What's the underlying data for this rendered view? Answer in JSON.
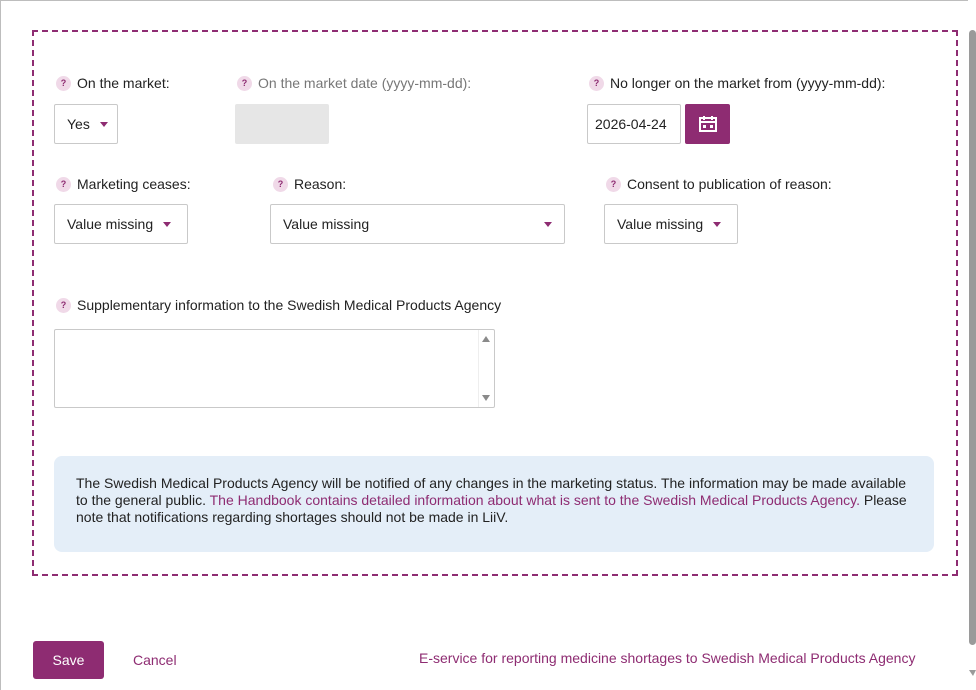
{
  "fields": {
    "on_market": {
      "label": "On the market:",
      "value": "Yes"
    },
    "on_market_date": {
      "label": "On the market date (yyyy-mm-dd):",
      "value": ""
    },
    "no_longer_on_market": {
      "label": "No longer on the market from (yyyy-mm-dd):",
      "value": "2026-04-24"
    },
    "marketing_ceases": {
      "label": "Marketing ceases:",
      "value": "Value missing"
    },
    "reason": {
      "label": "Reason:",
      "value": "Value missing"
    },
    "consent": {
      "label": "Consent to publication of reason:",
      "value": "Value missing"
    },
    "supplementary": {
      "label": "Supplementary information to the Swedish Medical Products Agency",
      "value": ""
    }
  },
  "help_icon_glyph": "?",
  "info": {
    "text_1": "The Swedish Medical Products Agency will be notified of any changes in the marketing status. The information may be made available to the general public.",
    "link": "The Handbook contains detailed information about what is sent to the Swedish Medical Products Agency.",
    "text_2": "Please note that notifications regarding shortages should not be made in LiiV."
  },
  "actions": {
    "save": "Save",
    "cancel": "Cancel",
    "eservice_link": "E-service for reporting medicine shortages to Swedish Medical Products Agency"
  },
  "icons": {
    "help": "help-icon",
    "calendar": "calendar-icon",
    "dropdown": "chevron-down-icon"
  },
  "colors": {
    "accent": "#8e2c72",
    "info_bg": "#e4eef8",
    "disabled_bg": "#e6e6e6"
  }
}
